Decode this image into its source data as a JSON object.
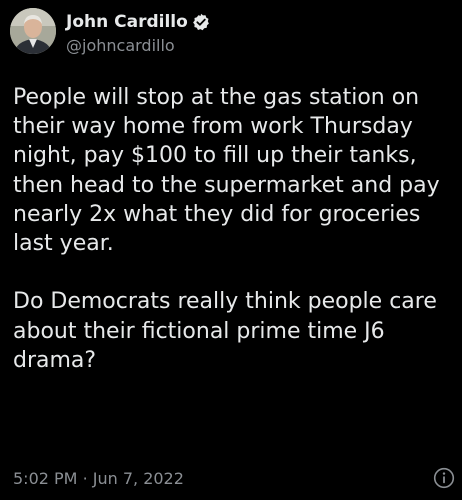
{
  "author": {
    "display_name": "John Cardillo",
    "handle": "@johncardillo",
    "verified_icon": "verified-badge-icon"
  },
  "tweet": {
    "paragraphs": [
      "People will stop at the gas station on their way home from work Thursday night, pay $100 to fill up their tanks, then head to the supermarket and pay nearly 2x what they did for groceries last year.",
      "Do Democrats really think people care about their fictional prime time J6 drama?"
    ],
    "time": "5:02 PM",
    "separator": "·",
    "date": "Jun 7, 2022"
  },
  "footer": {
    "info_icon": "info-icon"
  },
  "colors": {
    "background": "#000000",
    "text": "#e7e9ea",
    "secondary_text": "#8b8f94"
  }
}
